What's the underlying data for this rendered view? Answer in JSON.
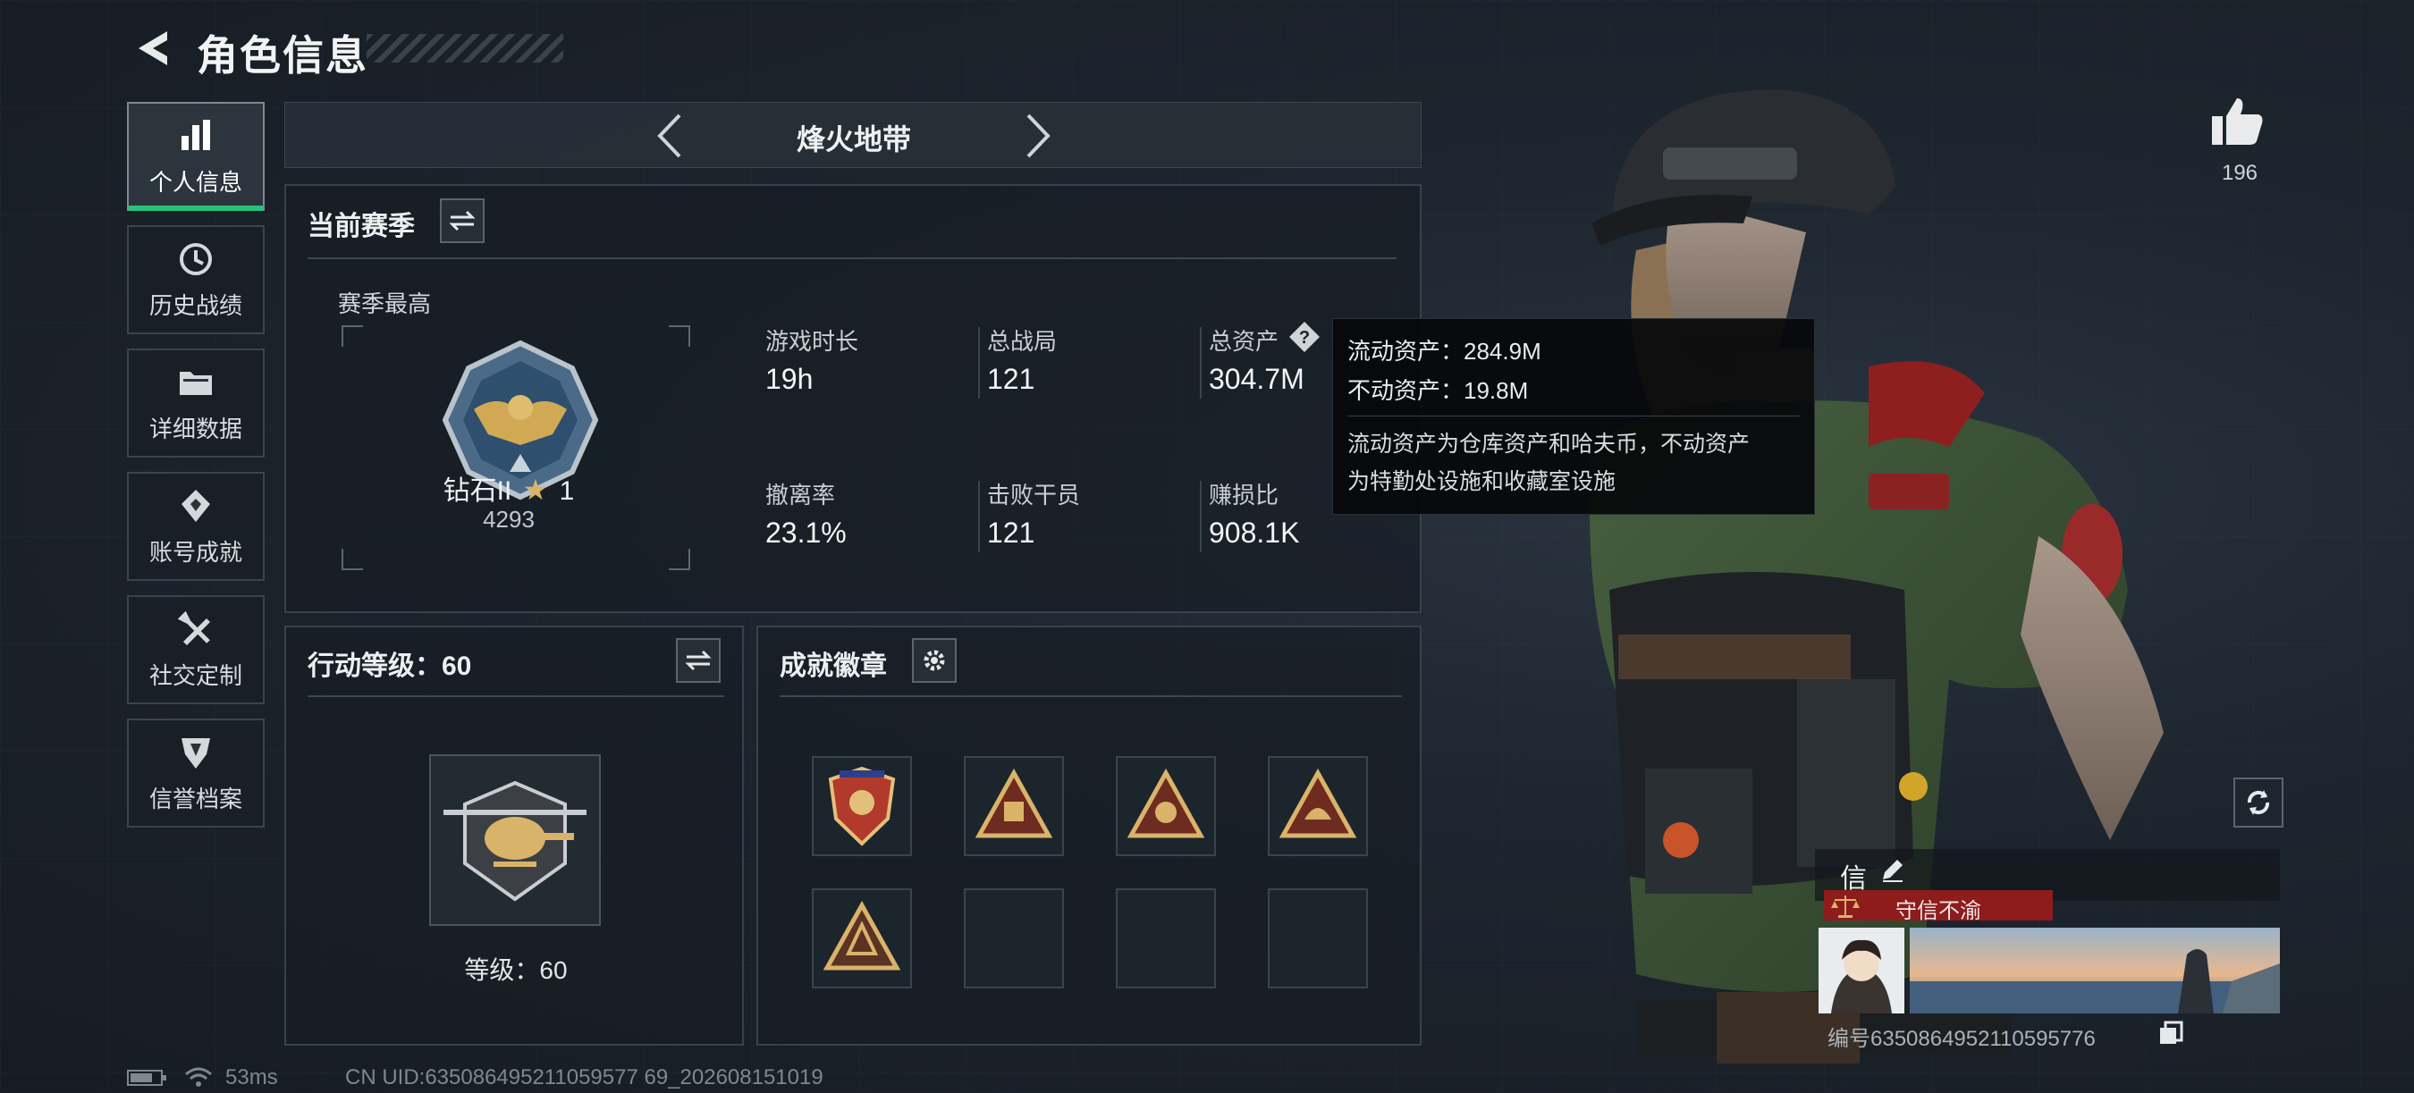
{
  "header": {
    "title": "角色信息"
  },
  "sidebar": {
    "items": [
      {
        "label": "个人信息",
        "icon": "bar-chart-icon",
        "active": true
      },
      {
        "label": "历史战绩",
        "icon": "clock-history-icon",
        "active": false
      },
      {
        "label": "详细数据",
        "icon": "folder-icon",
        "active": false
      },
      {
        "label": "账号成就",
        "icon": "achievement-icon",
        "active": false
      },
      {
        "label": "社交定制",
        "icon": "tools-icon",
        "active": false
      },
      {
        "label": "信誉档案",
        "icon": "credit-shield-icon",
        "active": false
      }
    ]
  },
  "mode": {
    "name": "烽火地带"
  },
  "season": {
    "title": "当前赛季",
    "best_label": "赛季最高",
    "rank_name": "钻石II",
    "rank_stars": "1",
    "rank_score": "4293",
    "stats": [
      {
        "label": "游戏时长",
        "value": "19h"
      },
      {
        "label": "总战局",
        "value": "121"
      },
      {
        "label": "总资产",
        "value": "304.7M"
      },
      {
        "label": "撤离率",
        "value": "23.1%"
      },
      {
        "label": "击败干员",
        "value": "121"
      },
      {
        "label": "赚损比",
        "value": "908.1K"
      }
    ]
  },
  "tooltip": {
    "liquid": "流动资产：284.9M",
    "fixed": "不动资产：19.8M",
    "desc_line1": "流动资产为仓库资产和哈夫币，不动资产",
    "desc_line2": "为特勤处设施和收藏室设施"
  },
  "action_level": {
    "title": "行动等级：60",
    "level_text": "等级：60"
  },
  "badges": {
    "title": "成就徽章",
    "filled": 5,
    "total": 8
  },
  "likes": {
    "count": "196"
  },
  "profile": {
    "name": "信",
    "credit_title": "守信不渝",
    "id_text": "编号6350864952110595776"
  },
  "footer": {
    "ping": "53ms",
    "uid": "CN UID:635086495211059577 69_202608151019"
  },
  "colors": {
    "accent_green": "#27c27c",
    "credit_red": "#8e1c1c",
    "gold": "#d9b36a"
  }
}
